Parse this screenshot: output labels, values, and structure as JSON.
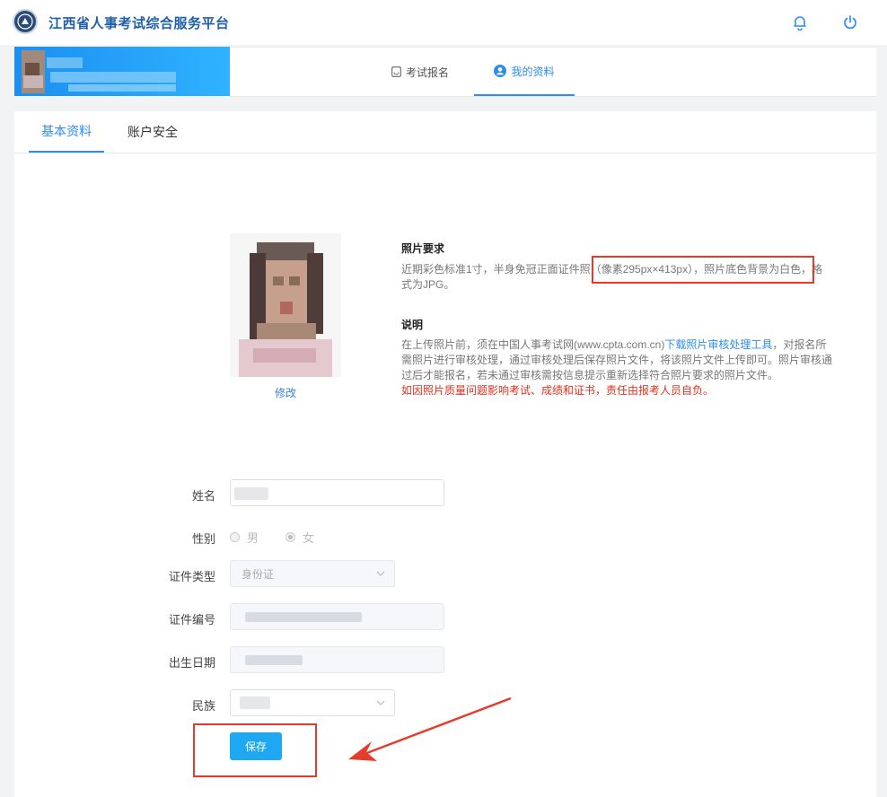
{
  "header": {
    "site_title": "江西省人事考试综合服务平台",
    "icons": [
      "logo-emblem",
      "bell-icon",
      "power-icon"
    ]
  },
  "nav": {
    "tabs": [
      {
        "label": "考试报名",
        "icon": "exam-icon"
      },
      {
        "label": "我的资料",
        "icon": "user-icon",
        "active": true
      }
    ]
  },
  "subtabs": {
    "basic": "基本资料",
    "security": "账户安全"
  },
  "photo": {
    "edit_label": "修改"
  },
  "requirements": {
    "title1": "照片要求",
    "body1_part1": "近期彩色标准1寸，半身免冠正面证件照",
    "body1_highlight": "（像素295px×413px），照片底色背景为白色",
    "body1_part2": "，格式为JPG。",
    "title2": "说明",
    "body2_part1": "在上传照片前，须在中国人事考试网(www.cpta.com.cn)",
    "body2_link": "下载照片审核处理工具",
    "body2_part2": "，对报名所需照片进行审核处理，通过审核处理后保存照片文件，将该照片文件上传即可。照片审核通过后才能报名，若未通过审核需按信息提示重新选择符合照片要求的照片文件。",
    "warning": "如因照片质量问题影响考试、成绩和证书，责任由报考人员自负。"
  },
  "form": {
    "name_label": "姓名",
    "gender_label": "性别",
    "gender_male": "男",
    "gender_female": "女",
    "gender_selected": "女",
    "id_type_label": "证件类型",
    "id_type_value": "身份证",
    "id_number_label": "证件编号",
    "birth_label": "出生日期",
    "ethnicity_label": "民族",
    "save_label": "保存"
  },
  "colors": {
    "accent": "#2d8cf0",
    "title_blue": "#1f5fa8",
    "warning_red": "#e0301e",
    "annotation_red": "#e53b2c",
    "button_blue": "#1ea8f2"
  }
}
